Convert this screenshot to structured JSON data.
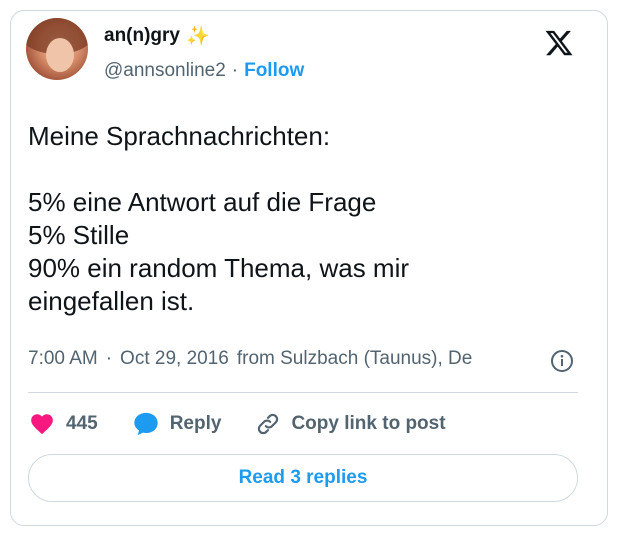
{
  "author": {
    "display_name": "an(n)gry",
    "name_emoji": "✨",
    "handle": "@annsonline2",
    "separator": "·",
    "follow_label": "Follow"
  },
  "tweet": {
    "lines": [
      "Meine Sprachnachrichten:",
      "",
      "5% eine Antwort auf die Frage",
      "5% Stille",
      "90% ein random Thema, was mir",
      "eingefallen ist."
    ]
  },
  "meta": {
    "time": "7:00 AM",
    "separator": "·",
    "date": "Oct 29, 2016",
    "location": "from Sulzbach (Taunus), De"
  },
  "actions": {
    "like_count": "445",
    "reply_label": "Reply",
    "copy_label": "Copy link to post"
  },
  "read_replies_label": "Read 3 replies",
  "colors": {
    "accent": "#1d9bf0",
    "like": "#f91880",
    "muted": "#536471",
    "border": "#cfd9de"
  }
}
